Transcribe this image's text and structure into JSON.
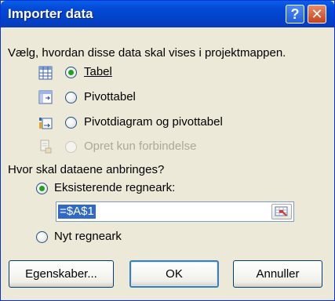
{
  "window": {
    "title": "Importer data",
    "help_glyph": "?",
    "close_glyph": "✕"
  },
  "display": {
    "prompt": "Vælg, hvordan disse data skal vises i projektmappen.",
    "options": [
      {
        "label": "Tabel",
        "icon": "table-icon",
        "selected": true,
        "enabled": true
      },
      {
        "label": "Pivottabel",
        "icon": "pivot-table-icon",
        "selected": false,
        "enabled": true
      },
      {
        "label": "Pivotdiagram og pivottabel",
        "icon": "pivot-chart-icon",
        "selected": false,
        "enabled": true
      },
      {
        "label": "Opret kun forbindelse",
        "icon": "connection-icon",
        "selected": false,
        "enabled": false
      }
    ]
  },
  "location": {
    "prompt": "Hvor skal dataene anbringes?",
    "existing_label": "Eksisterende regneark:",
    "existing_selected": true,
    "cell_ref": "=$A$1",
    "new_label": "Nyt regneark",
    "new_selected": false
  },
  "buttons": {
    "properties": "Egenskaber...",
    "ok": "OK",
    "cancel": "Annuller"
  },
  "colors": {
    "titlebar": "#0349d6",
    "dialog_bg": "#ece9d8",
    "radio_dot": "#21a121",
    "selection": "#316ac5"
  }
}
